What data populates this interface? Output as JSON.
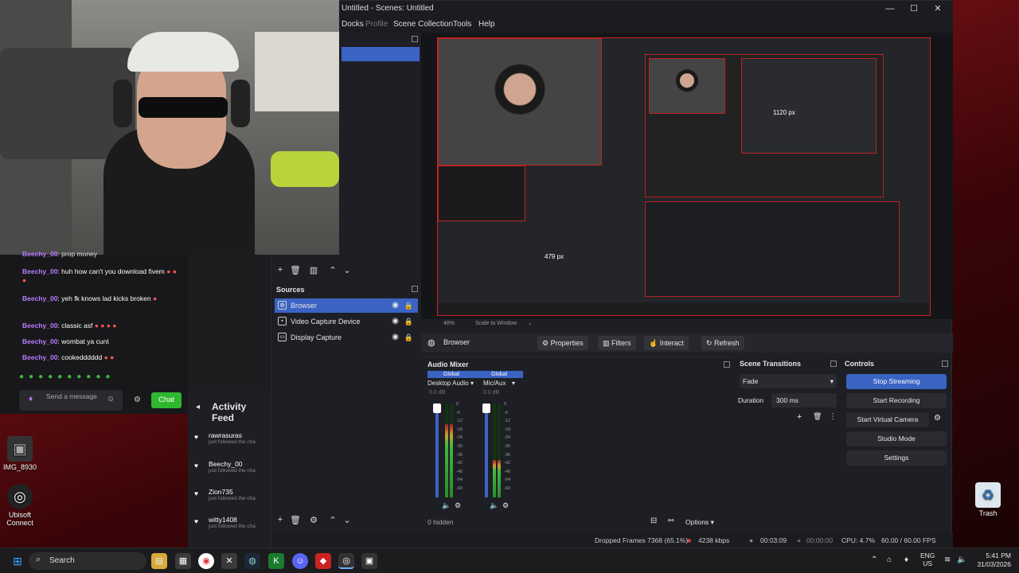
{
  "desktop": {
    "icons": [
      {
        "label": "Trash",
        "icon": "recycle-bin-icon"
      },
      {
        "label": "Ubisoft Connect",
        "icon": "ubisoft-icon"
      },
      {
        "label": "IMG_8930",
        "icon": "image-file-icon"
      }
    ]
  },
  "obs": {
    "title": "Untitled - Scenes: Untitled",
    "menu": [
      "Docks",
      "Profile",
      "Scene Collection",
      "Tools",
      "Help"
    ],
    "preview": {
      "zoom": "48%",
      "scale_mode": "Scale to Window",
      "size_label_1": "1120 px",
      "size_label_2": "479 px"
    },
    "sources": {
      "title": "Sources",
      "items": [
        {
          "name": "Browser",
          "icon": "globe-icon",
          "selected": true
        },
        {
          "name": "Video Capture Device",
          "icon": "camera-icon",
          "selected": false
        },
        {
          "name": "Display Capture",
          "icon": "monitor-icon",
          "selected": false
        }
      ]
    },
    "context": {
      "source": "Browser",
      "properties": "Properties",
      "filters": "Filters",
      "interact": "Interact",
      "refresh": "Refresh"
    },
    "mixer": {
      "title": "Audio Mixer",
      "channels": [
        {
          "tag": "Global",
          "name": "Desktop Audio",
          "db": "0.0 dB",
          "level": 0.78
        },
        {
          "tag": "Global",
          "name": "Mic/Aux",
          "db": "0.0 dB",
          "level": 0.4
        }
      ],
      "scale": [
        "0",
        "-6",
        "-12",
        "-18",
        "-24",
        "-30",
        "-36",
        "-42",
        "-48",
        "-54",
        "-60"
      ],
      "hidden": "0 hidden",
      "options": "Options"
    },
    "transitions": {
      "title": "Scene Transitions",
      "selected": "Fade",
      "duration_label": "Duration",
      "duration": "300 ms"
    },
    "controls": {
      "title": "Controls",
      "buttons": [
        "Stop Streaming",
        "Start Recording",
        "Start Virtual Camera",
        "Studio Mode",
        "Settings"
      ]
    },
    "status": {
      "dropped": "Dropped Frames 7368 (65.1%)",
      "kbps": "4238 kbps",
      "stream_time": "00:03:09",
      "rec_time": "00:00:00",
      "cpu": "CPU: 4.7%",
      "fps": "60.00 / 60.00 FPS"
    }
  },
  "chat": {
    "partial_top": "prop money",
    "messages": [
      {
        "user": "Beechy_00",
        "text": ": huh how can't you download fivem"
      },
      {
        "user": "Beechy_00",
        "text": ": yeh fk knows lad kicks broken"
      },
      {
        "user": "Beechy_00",
        "text": ": classic asf"
      },
      {
        "user": "Beechy_00",
        "text": ": wombat ya cunt"
      },
      {
        "user": "Beechy_00",
        "text": ": cookedddddd"
      }
    ],
    "input_placeholder": "Send a message",
    "chat_button": "Chat"
  },
  "activity": {
    "title": "Activity Feed",
    "items": [
      {
        "name": "rawrasuras",
        "sub": "just followed the cha"
      },
      {
        "name": "Beechy_00",
        "sub": "just followed the cha"
      },
      {
        "name": "Zion735",
        "sub": "just followed the cha"
      },
      {
        "name": "witty1408",
        "sub": "just followed the cha"
      }
    ]
  },
  "taskbar": {
    "search": "Search",
    "lang_top": "ENG",
    "lang_bottom": "US",
    "time": "5:41 PM",
    "date": "31/03/2026"
  }
}
